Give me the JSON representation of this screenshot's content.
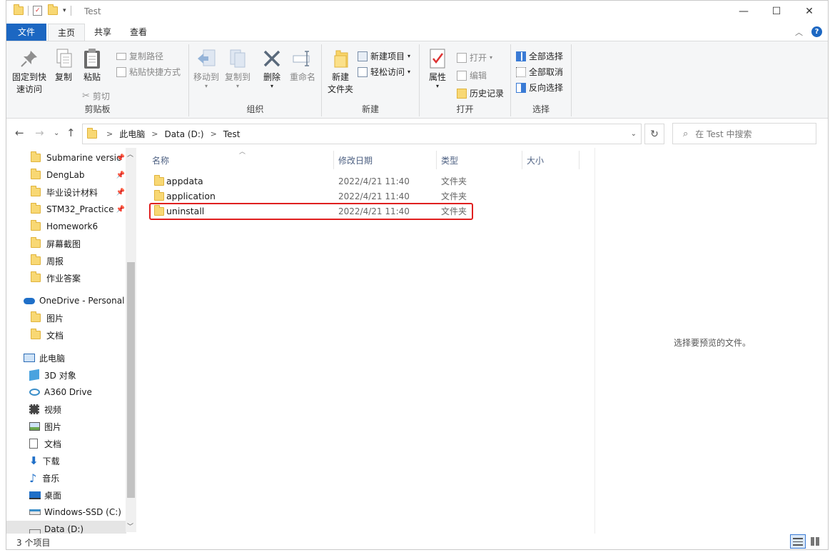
{
  "window": {
    "title": "Test",
    "controls": {
      "minimize": "—",
      "maximize": "☐",
      "close": "✕"
    }
  },
  "ribbon": {
    "tabs": [
      {
        "label": "文件"
      },
      {
        "label": "主页"
      },
      {
        "label": "共享"
      },
      {
        "label": "查看"
      }
    ],
    "clipboard": {
      "group": "剪贴板",
      "pin_line1": "固定到快",
      "pin_line2": "速访问",
      "copy": "复制",
      "paste": "粘贴",
      "copy_path": "复制路径",
      "paste_shortcut": "粘贴快捷方式",
      "cut": "剪切"
    },
    "organize": {
      "group": "组织",
      "move_to": "移动到",
      "copy_to": "复制到",
      "delete": "删除",
      "rename": "重命名"
    },
    "new": {
      "group": "新建",
      "new_folder_line1": "新建",
      "new_folder_line2": "文件夹",
      "new_item": "新建项目",
      "easy_access": "轻松访问"
    },
    "open": {
      "group": "打开",
      "properties": "属性",
      "open": "打开",
      "edit": "编辑",
      "history": "历史记录"
    },
    "select": {
      "group": "选择",
      "select_all": "全部选择",
      "select_none": "全部取消",
      "invert": "反向选择"
    }
  },
  "address": {
    "crumbs": [
      "此电脑",
      "Data (D:)",
      "Test"
    ],
    "search_placeholder": "在 Test 中搜索"
  },
  "nav": {
    "quick_access": [
      {
        "label": "Submarine versic",
        "pinned": true
      },
      {
        "label": "DengLab",
        "pinned": true
      },
      {
        "label": "毕业设计材料",
        "pinned": true
      },
      {
        "label": "STM32_Practice",
        "pinned": true
      },
      {
        "label": "Homework6",
        "pinned": false
      },
      {
        "label": "屏幕截图",
        "pinned": false
      },
      {
        "label": "周报",
        "pinned": false
      },
      {
        "label": "作业答案",
        "pinned": false
      }
    ],
    "onedrive": {
      "label": "OneDrive - Personal",
      "children": [
        "图片",
        "文档"
      ]
    },
    "this_pc": {
      "label": "此电脑",
      "children": [
        "3D 对象",
        "A360 Drive",
        "视频",
        "图片",
        "文档",
        "下载",
        "音乐",
        "桌面",
        "Windows-SSD (C:)",
        "Data (D:)"
      ]
    }
  },
  "files": {
    "columns": [
      "名称",
      "修改日期",
      "类型",
      "大小"
    ],
    "rows": [
      {
        "name": "appdata",
        "date": "2022/4/21 11:40",
        "type": "文件夹"
      },
      {
        "name": "application",
        "date": "2022/4/21 11:40",
        "type": "文件夹"
      },
      {
        "name": "uninstall",
        "date": "2022/4/21 11:40",
        "type": "文件夹"
      }
    ],
    "highlighted_row": "uninstall"
  },
  "preview_text": "选择要预览的文件。",
  "status": {
    "count": "3 个项目"
  },
  "colors": {
    "accent": "#1c67c2",
    "folder": "#f8d874",
    "highlight": "#e02020"
  }
}
